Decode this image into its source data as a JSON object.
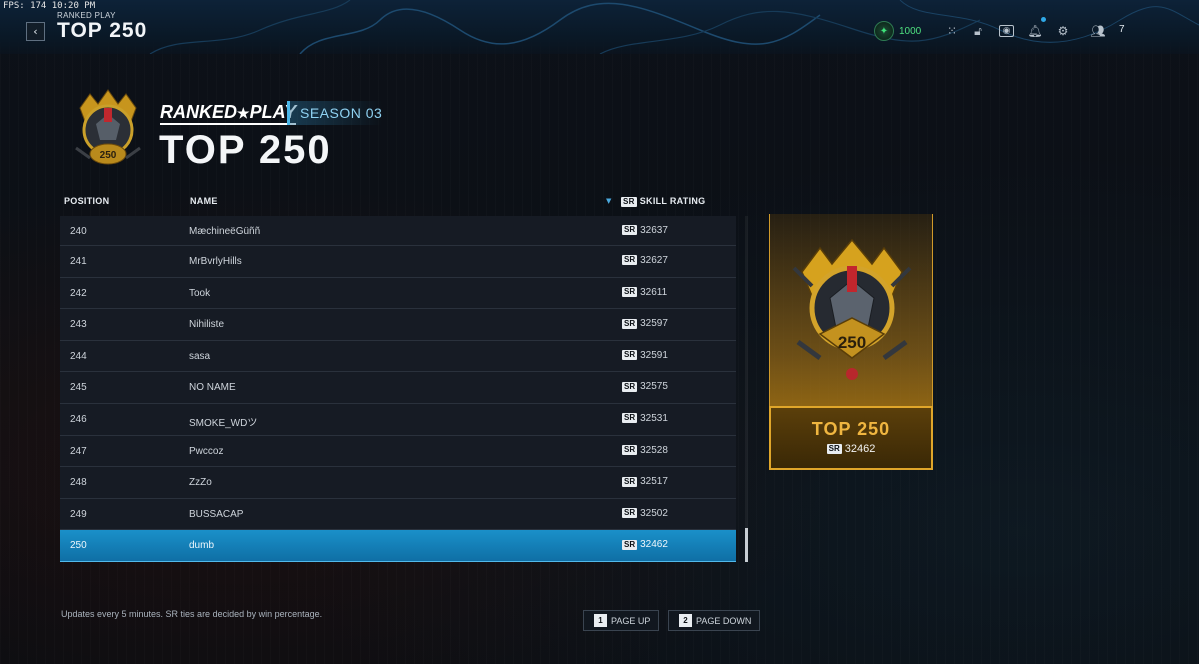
{
  "overlay": {
    "fps_text": "FPS: 174  10:20 PM"
  },
  "header": {
    "breadcrumb": "RANKED PLAY",
    "title": "TOP 250",
    "currency": "1000",
    "party_count": "7"
  },
  "banner": {
    "logo_text_left": "RANKED",
    "logo_star": "★",
    "logo_text_right": "PLAY",
    "season": "SEASON 03",
    "title": "TOP 250"
  },
  "table": {
    "headers": {
      "position": "POSITION",
      "name": "NAME",
      "sr_badge": "SR",
      "skill": "SKILL RATING"
    },
    "rows": [
      {
        "pos": "240",
        "name": "MæchineëGüññ",
        "sr": "32637"
      },
      {
        "pos": "241",
        "name": "MrBvrlyHills",
        "sr": "32627"
      },
      {
        "pos": "242",
        "name": "Took",
        "sr": "32611"
      },
      {
        "pos": "243",
        "name": "Nihiliste",
        "sr": "32597"
      },
      {
        "pos": "244",
        "name": "sasa",
        "sr": "32591"
      },
      {
        "pos": "245",
        "name": "NO NAME",
        "sr": "32575"
      },
      {
        "pos": "246",
        "name": "SMOKE_WDツ",
        "sr": "32531"
      },
      {
        "pos": "247",
        "name": "Pwccoz",
        "sr": "32528"
      },
      {
        "pos": "248",
        "name": "ZzZo",
        "sr": "32517"
      },
      {
        "pos": "249",
        "name": "BUSSACAP",
        "sr": "32502"
      },
      {
        "pos": "250",
        "name": "dumb",
        "sr": "32462"
      }
    ],
    "selected_index": 10
  },
  "rank_card": {
    "title": "TOP 250",
    "sr_badge": "SR",
    "sr_value": "32462",
    "emblem_number": "250"
  },
  "footer": {
    "note": "Updates every 5 minutes. SR ties are decided by win percentage.",
    "page_up_key": "1",
    "page_up": "PAGE UP",
    "page_down_key": "2",
    "page_down": "PAGE DOWN"
  },
  "colors": {
    "accent": "#1a90c9",
    "gold": "#e0a62a",
    "currency": "#4ee07f"
  }
}
